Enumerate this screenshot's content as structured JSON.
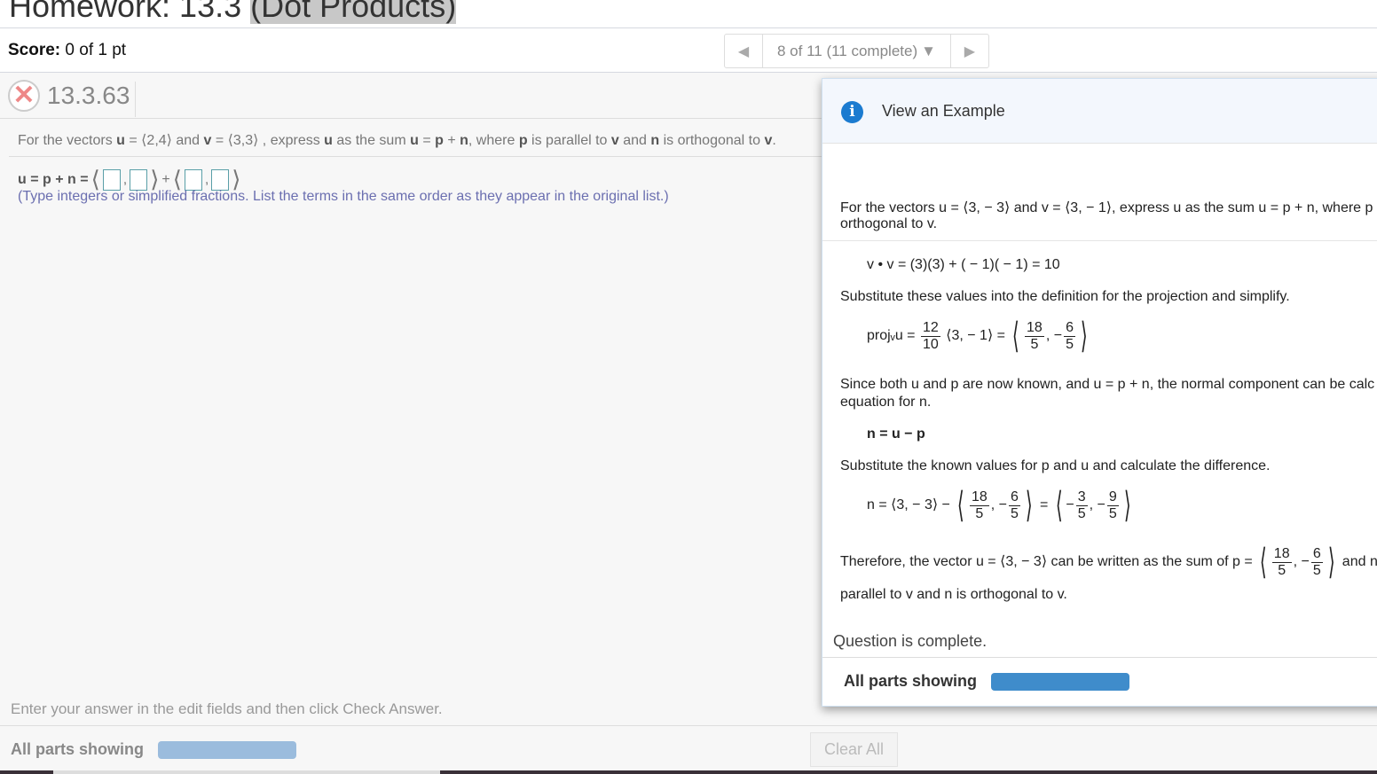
{
  "title": {
    "prefix": "Homework: 13.3 ",
    "highlight": "(Dot Products)"
  },
  "score": {
    "label": "Score:",
    "value": "0 of 1 pt"
  },
  "pager": {
    "prev_icon": "triangle-left-icon",
    "status": "8 of 11 (11 complete)",
    "dropdown_icon": "caret-down-icon",
    "next_icon": "triangle-right-icon"
  },
  "question": {
    "status_icon": "incorrect-x-icon",
    "number": "13.3.63",
    "text": [
      "For the vectors ",
      "u",
      " = ⟨2,4⟩ and ",
      "v",
      " = ⟨3,3⟩ , express ",
      "u",
      " as the sum ",
      "u",
      " = ",
      "p",
      " + ",
      "n",
      ", where ",
      "p",
      " is parallel to ",
      "v",
      " and ",
      "n",
      " is orthogonal to ",
      "v",
      "."
    ],
    "answer_lhs": "u = p + n =",
    "plus": "+",
    "hint": "(Type integers or simplified fractions. List the terms in the same order as they appear in the original list.)"
  },
  "footer": {
    "message": "Enter your answer in the edit fields and then click Check Answer.",
    "parts": "All parts showing",
    "clear": "Clear All"
  },
  "example": {
    "title": "View an Example",
    "info_icon": "info-icon",
    "intro1": "For the vectors u = ⟨3, − 3⟩ and v = ⟨3, − 1⟩, express u as the sum u = p + n, where p",
    "intro2": "orthogonal to v.",
    "vv": "v • v = (3)(3) + ( − 1)( − 1) = 10",
    "sub1": "Substitute these values into the definition for the projection and simplify.",
    "proj": {
      "lhs": "projᵥu =",
      "n1": "12",
      "d1": "10",
      "mid": "⟨3, − 1⟩ =",
      "n2": "18",
      "d2": "5",
      "sep": ", −",
      "n3": "6",
      "d3": "5"
    },
    "since1": "Since both u and p are now known, and u = p + n, the normal component can be calc",
    "since2": "equation for n.",
    "neq": "n = u − p",
    "sub2": "Substitute the known values for p and u and calculate the difference.",
    "ncalc": {
      "lhs": "n = ⟨3, − 3⟩ −",
      "n1": "18",
      "d1": "5",
      "sep": ", −",
      "n2": "6",
      "d2": "5",
      "eq": "=",
      "neg": "−",
      "n3": "3",
      "d3": "5",
      "sep2": ", −",
      "n4": "9",
      "d4": "5"
    },
    "there": {
      "pre": "Therefore, the vector u = ⟨3, − 3⟩ can be written as the sum of p =",
      "n1": "18",
      "d1": "5",
      "sep": ", −",
      "n2": "6",
      "d2": "5",
      "post": "and n ="
    },
    "there2": "parallel to v and n is orthogonal to v.",
    "complete": "Question is complete.",
    "parts": "All parts showing"
  },
  "colors": {
    "accent": "#1b7bd0",
    "progress": "#3f8ccb",
    "progress_muted": "#9bbcdd",
    "incorrect": "#e88888"
  }
}
